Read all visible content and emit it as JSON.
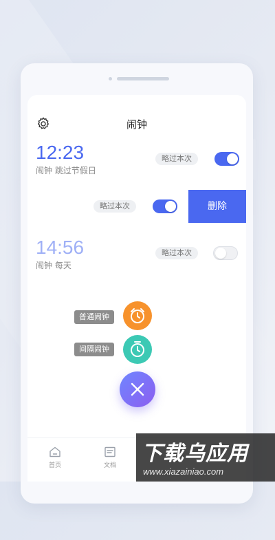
{
  "header": {
    "title": "闹钟",
    "settings_icon": "gear-icon"
  },
  "alarms": [
    {
      "time": "12:23",
      "desc": "闹钟 跳过节假日",
      "skip_label": "略过本次",
      "enabled": true,
      "color": "#4a68f0"
    },
    {
      "skip_label": "略过本次",
      "enabled": true,
      "delete_label": "删除"
    },
    {
      "time": "14:56",
      "desc": "闹钟 每天",
      "skip_label": "略过本次",
      "enabled": false,
      "color": "#9fb0f6"
    }
  ],
  "fab": {
    "options": [
      {
        "label": "普通闹钟",
        "icon": "alarm-clock-icon",
        "color": "#f7922c"
      },
      {
        "label": "间隔闹钟",
        "icon": "clock-icon",
        "color": "#3cc9b4"
      }
    ],
    "close_icon": "close-icon"
  },
  "tabbar": {
    "items": [
      {
        "label": "首页",
        "icon": "home-icon"
      },
      {
        "label": "文档",
        "icon": "document-icon"
      }
    ]
  },
  "watermark": {
    "text": "下载乌应用",
    "url": "www.xiazainiao.com"
  }
}
